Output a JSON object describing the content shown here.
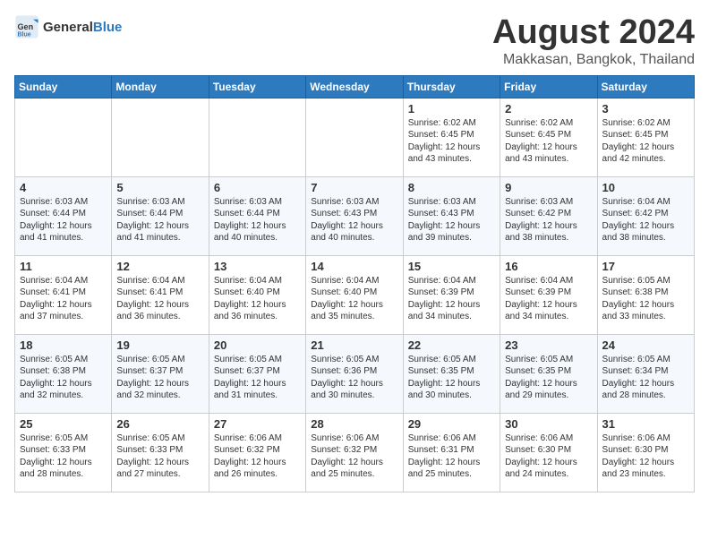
{
  "logo": {
    "general": "General",
    "blue": "Blue"
  },
  "title": "August 2024",
  "location": "Makkasan, Bangkok, Thailand",
  "days_of_week": [
    "Sunday",
    "Monday",
    "Tuesday",
    "Wednesday",
    "Thursday",
    "Friday",
    "Saturday"
  ],
  "weeks": [
    [
      {
        "day": "",
        "info": ""
      },
      {
        "day": "",
        "info": ""
      },
      {
        "day": "",
        "info": ""
      },
      {
        "day": "",
        "info": ""
      },
      {
        "day": "1",
        "info": "Sunrise: 6:02 AM\nSunset: 6:45 PM\nDaylight: 12 hours\nand 43 minutes."
      },
      {
        "day": "2",
        "info": "Sunrise: 6:02 AM\nSunset: 6:45 PM\nDaylight: 12 hours\nand 43 minutes."
      },
      {
        "day": "3",
        "info": "Sunrise: 6:02 AM\nSunset: 6:45 PM\nDaylight: 12 hours\nand 42 minutes."
      }
    ],
    [
      {
        "day": "4",
        "info": "Sunrise: 6:03 AM\nSunset: 6:44 PM\nDaylight: 12 hours\nand 41 minutes."
      },
      {
        "day": "5",
        "info": "Sunrise: 6:03 AM\nSunset: 6:44 PM\nDaylight: 12 hours\nand 41 minutes."
      },
      {
        "day": "6",
        "info": "Sunrise: 6:03 AM\nSunset: 6:44 PM\nDaylight: 12 hours\nand 40 minutes."
      },
      {
        "day": "7",
        "info": "Sunrise: 6:03 AM\nSunset: 6:43 PM\nDaylight: 12 hours\nand 40 minutes."
      },
      {
        "day": "8",
        "info": "Sunrise: 6:03 AM\nSunset: 6:43 PM\nDaylight: 12 hours\nand 39 minutes."
      },
      {
        "day": "9",
        "info": "Sunrise: 6:03 AM\nSunset: 6:42 PM\nDaylight: 12 hours\nand 38 minutes."
      },
      {
        "day": "10",
        "info": "Sunrise: 6:04 AM\nSunset: 6:42 PM\nDaylight: 12 hours\nand 38 minutes."
      }
    ],
    [
      {
        "day": "11",
        "info": "Sunrise: 6:04 AM\nSunset: 6:41 PM\nDaylight: 12 hours\nand 37 minutes."
      },
      {
        "day": "12",
        "info": "Sunrise: 6:04 AM\nSunset: 6:41 PM\nDaylight: 12 hours\nand 36 minutes."
      },
      {
        "day": "13",
        "info": "Sunrise: 6:04 AM\nSunset: 6:40 PM\nDaylight: 12 hours\nand 36 minutes."
      },
      {
        "day": "14",
        "info": "Sunrise: 6:04 AM\nSunset: 6:40 PM\nDaylight: 12 hours\nand 35 minutes."
      },
      {
        "day": "15",
        "info": "Sunrise: 6:04 AM\nSunset: 6:39 PM\nDaylight: 12 hours\nand 34 minutes."
      },
      {
        "day": "16",
        "info": "Sunrise: 6:04 AM\nSunset: 6:39 PM\nDaylight: 12 hours\nand 34 minutes."
      },
      {
        "day": "17",
        "info": "Sunrise: 6:05 AM\nSunset: 6:38 PM\nDaylight: 12 hours\nand 33 minutes."
      }
    ],
    [
      {
        "day": "18",
        "info": "Sunrise: 6:05 AM\nSunset: 6:38 PM\nDaylight: 12 hours\nand 32 minutes."
      },
      {
        "day": "19",
        "info": "Sunrise: 6:05 AM\nSunset: 6:37 PM\nDaylight: 12 hours\nand 32 minutes."
      },
      {
        "day": "20",
        "info": "Sunrise: 6:05 AM\nSunset: 6:37 PM\nDaylight: 12 hours\nand 31 minutes."
      },
      {
        "day": "21",
        "info": "Sunrise: 6:05 AM\nSunset: 6:36 PM\nDaylight: 12 hours\nand 30 minutes."
      },
      {
        "day": "22",
        "info": "Sunrise: 6:05 AM\nSunset: 6:35 PM\nDaylight: 12 hours\nand 30 minutes."
      },
      {
        "day": "23",
        "info": "Sunrise: 6:05 AM\nSunset: 6:35 PM\nDaylight: 12 hours\nand 29 minutes."
      },
      {
        "day": "24",
        "info": "Sunrise: 6:05 AM\nSunset: 6:34 PM\nDaylight: 12 hours\nand 28 minutes."
      }
    ],
    [
      {
        "day": "25",
        "info": "Sunrise: 6:05 AM\nSunset: 6:33 PM\nDaylight: 12 hours\nand 28 minutes."
      },
      {
        "day": "26",
        "info": "Sunrise: 6:05 AM\nSunset: 6:33 PM\nDaylight: 12 hours\nand 27 minutes."
      },
      {
        "day": "27",
        "info": "Sunrise: 6:06 AM\nSunset: 6:32 PM\nDaylight: 12 hours\nand 26 minutes."
      },
      {
        "day": "28",
        "info": "Sunrise: 6:06 AM\nSunset: 6:32 PM\nDaylight: 12 hours\nand 25 minutes."
      },
      {
        "day": "29",
        "info": "Sunrise: 6:06 AM\nSunset: 6:31 PM\nDaylight: 12 hours\nand 25 minutes."
      },
      {
        "day": "30",
        "info": "Sunrise: 6:06 AM\nSunset: 6:30 PM\nDaylight: 12 hours\nand 24 minutes."
      },
      {
        "day": "31",
        "info": "Sunrise: 6:06 AM\nSunset: 6:30 PM\nDaylight: 12 hours\nand 23 minutes."
      }
    ]
  ]
}
